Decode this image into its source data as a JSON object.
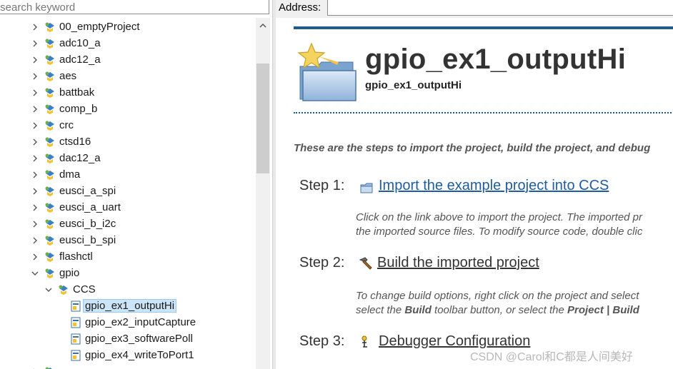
{
  "search": {
    "placeholder": "r search keyword"
  },
  "tree": {
    "items": [
      {
        "label": "00_emptyProject"
      },
      {
        "label": "adc10_a"
      },
      {
        "label": "adc12_a"
      },
      {
        "label": "aes"
      },
      {
        "label": "battbak"
      },
      {
        "label": "comp_b"
      },
      {
        "label": "crc"
      },
      {
        "label": "ctsd16"
      },
      {
        "label": "dac12_a"
      },
      {
        "label": "dma"
      },
      {
        "label": "eusci_a_spi"
      },
      {
        "label": "eusci_a_uart"
      },
      {
        "label": "eusci_b_i2c"
      },
      {
        "label": "eusci_b_spi"
      },
      {
        "label": "flashctl"
      },
      {
        "label": "gpio"
      }
    ],
    "ccs_label": "CCS",
    "files": [
      {
        "label": "gpio_ex1_outputHi",
        "selected": true
      },
      {
        "label": "gpio_ex2_inputCapture"
      },
      {
        "label": "gpio_ex3_softwarePoll"
      },
      {
        "label": "gpio_ex4_writeToPort1"
      }
    ]
  },
  "address": {
    "label": "Address:",
    "value": ""
  },
  "page": {
    "title": "gpio_ex1_outputHi",
    "subtitle": "gpio_ex1_outputHi",
    "intro": "These are the steps to import the project, build the project, and debug",
    "steps": [
      {
        "label": "Step 1:",
        "link": "Import the example project into CCS",
        "icon": "import-project-icon",
        "desc": [
          "Click on the link above to import the project. The imported pr",
          "the imported source files. To modify source code, double clic"
        ]
      },
      {
        "label": "Step 2:",
        "link": "Build the imported project",
        "icon": "hammer-icon",
        "desc": [
          "To change build options, right click on the project and select",
          "select the Build toolbar button, or select the Project | Build"
        ]
      },
      {
        "label": "Step 3:",
        "link": "Debugger Configuration",
        "icon": "debugger-icon",
        "desc": []
      }
    ]
  },
  "watermark": "CSDN @Carol和C都是人间美好",
  "colors": {
    "accent": "#1f5b8f",
    "link": "#1f5da0",
    "selection": "#cce4f7"
  }
}
